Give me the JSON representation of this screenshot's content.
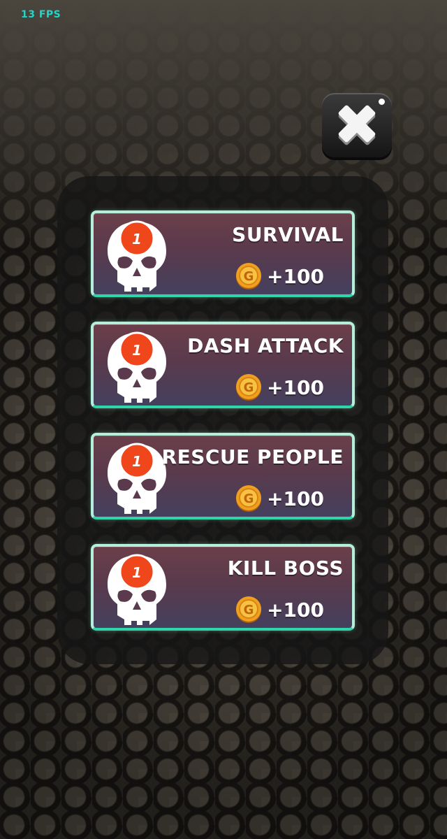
{
  "hud": {
    "fps": "13 FPS"
  },
  "close_button": {
    "icon": "close-icon"
  },
  "missions": [
    {
      "title": "SURVIVAL",
      "count": "1",
      "reward": "+100",
      "reward_icon": "gold-coin-icon"
    },
    {
      "title": "DASH ATTACK",
      "count": "1",
      "reward": "+100",
      "reward_icon": "gold-coin-icon"
    },
    {
      "title": "RESCUE PEOPLE",
      "count": "1",
      "reward": "+100",
      "reward_icon": "gold-coin-icon"
    },
    {
      "title": "KILL BOSS",
      "count": "1",
      "reward": "+100",
      "reward_icon": "gold-coin-icon"
    }
  ],
  "colors": {
    "fps_text": "#21d6c9",
    "badge": "#f0461c",
    "card_border": "#2fd4a8",
    "coin": "#f0a020"
  }
}
